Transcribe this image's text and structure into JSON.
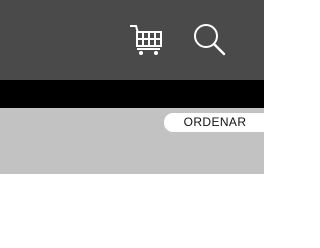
{
  "header": {
    "cart_icon": "shopping-cart-icon",
    "search_icon": "search-icon"
  },
  "toolbar": {
    "sort_label": "ORDENAR"
  },
  "colors": {
    "header_bg": "#4a4a4a",
    "divider_bg": "#000000",
    "toolbar_bg": "#c2c2c2",
    "icon_color": "#ffffff"
  }
}
